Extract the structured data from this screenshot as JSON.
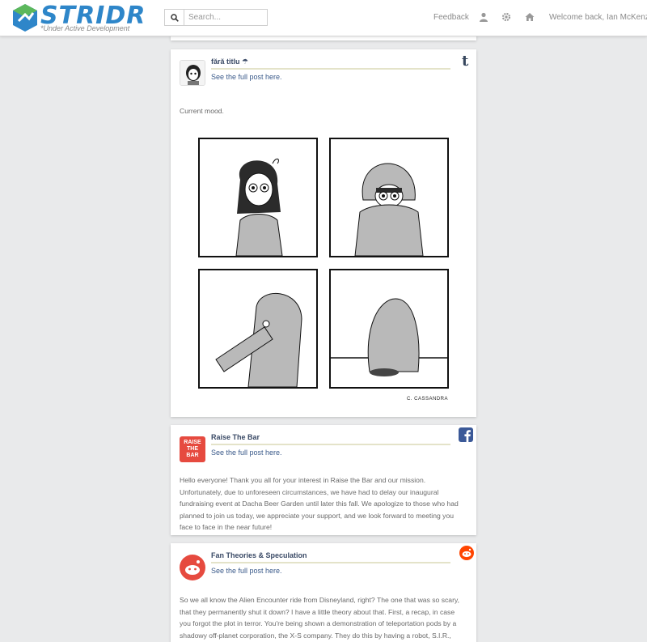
{
  "app": {
    "logo_text": "STRIDR",
    "logo_sub": "*Under Active Development",
    "brand_color": "#2e86c9"
  },
  "search": {
    "placeholder": "Search...",
    "value": ""
  },
  "nav": {
    "feedback": "Feedback",
    "welcome": "Welcome back, Ian McKenzie",
    "icons": [
      "user-icon",
      "gear-icon",
      "home-icon"
    ]
  },
  "posts": [
    {
      "source": "tumblr",
      "title": "fără titlu ☂",
      "link": "See the full post here.",
      "body": "Current mood.",
      "comic_credit": "C. CASSANDRA"
    },
    {
      "source": "facebook",
      "title": "Raise The Bar",
      "avatar_text": "RAISE THE BAR",
      "link": "See the full post here.",
      "body": "Hello everyone! Thank you all for your interest in Raise the Bar and our mission. Unfortunately, due to unforeseen circumstances, we have had to delay our inaugural fundraising event at Dacha Beer Garden until later this fall. We apologize to those who had planned to join us today, we appreciate your support, and we look forward to meeting you face to face in the near future!"
    },
    {
      "source": "reddit",
      "title": "Fan Theories & Speculation",
      "link": "See the full post here.",
      "body": "So we all know the Alien Encounter ride from Disneyland, right? The one that was so scary, that they permanently shut it down? I have a little theory about that. First, a recap, in case you forgot the plot in terror. You're being shown a demonstration of teleportation pods by a shadowy off-planet corporation, the X-S company. They do this by having a robot, S.I.R., demonstrate the pods"
    }
  ],
  "colors": {
    "tumblr": "#36465d",
    "facebook": "#3b5998",
    "reddit": "#ff4500",
    "raise_the_bar": "#e64a3f",
    "rule": "#e4e3c9"
  }
}
